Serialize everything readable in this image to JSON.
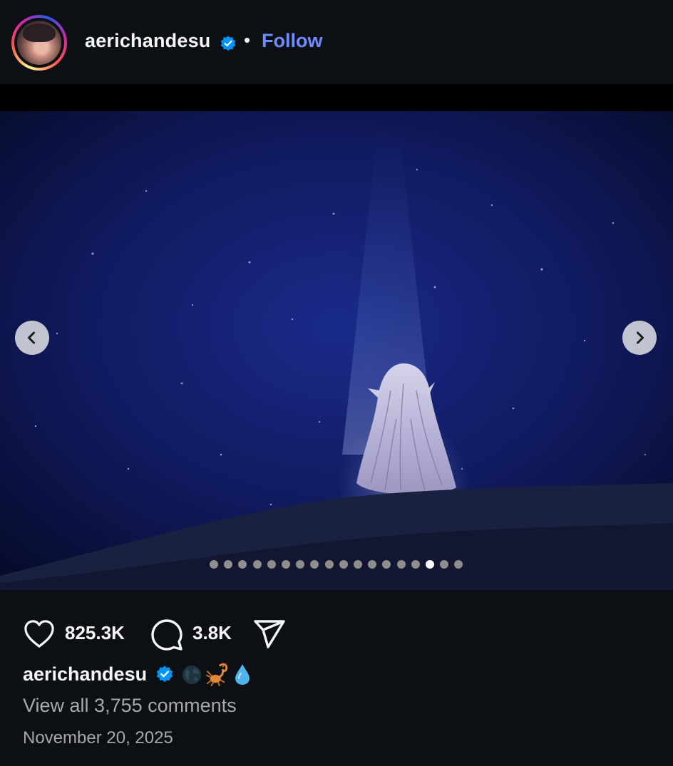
{
  "header": {
    "username": "aerichandesu",
    "separator": "•",
    "follow_label": "Follow"
  },
  "media": {
    "carousel_total": 18,
    "carousel_active_index": 15,
    "accent_active_dot": "#ffffff",
    "accent_inactive_dot": "#8e8e8e"
  },
  "actions": {
    "likes": "825.3K",
    "comments_count": "3.8K"
  },
  "caption": {
    "username": "aerichandesu",
    "emojis": [
      "globe-emoji",
      "scorpion-emoji",
      "droplet-emoji"
    ]
  },
  "view_comments": "View all 3,755 comments",
  "date": "November 20, 2025",
  "colors": {
    "background": "#0c1014",
    "follow": "#708dfe",
    "verified": "#0095f6",
    "secondary_text": "#a8a8a8"
  }
}
